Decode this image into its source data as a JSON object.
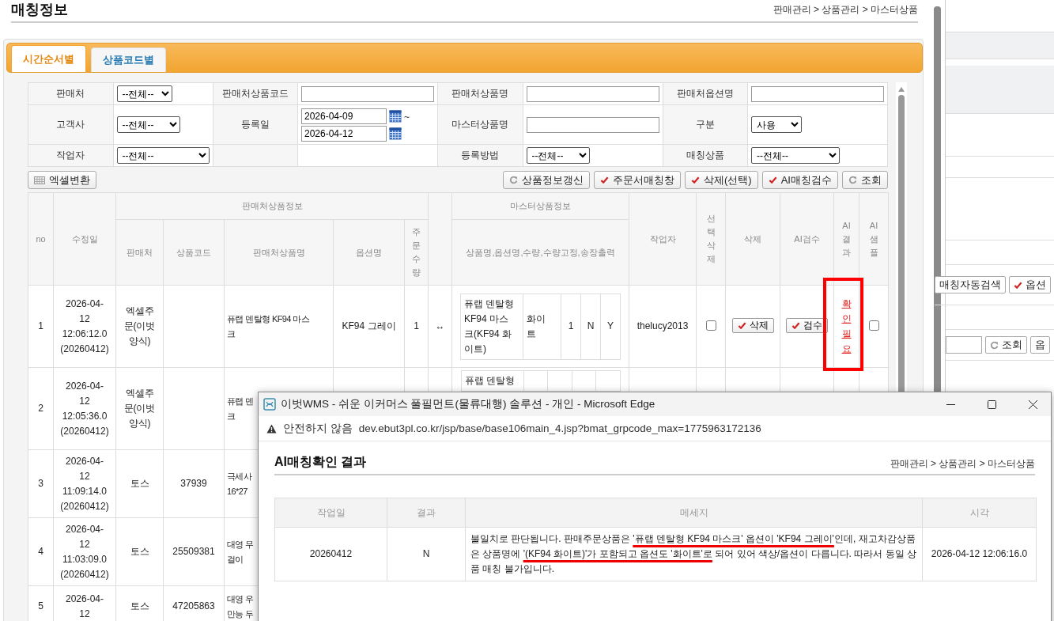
{
  "page": {
    "title": "매칭정보",
    "breadcrumb": "판매관리 > 상품관리 > 마스터상품"
  },
  "tabs": [
    {
      "label": "시간순서별",
      "selected": true
    },
    {
      "label": "상품코드별",
      "selected": false
    }
  ],
  "filters": [
    {
      "label": "판매처",
      "kind": "select",
      "value": "--전체--"
    },
    {
      "label": "판매처상품코드",
      "kind": "input"
    },
    {
      "label": "판매처상품명",
      "kind": "input"
    },
    {
      "label": "판매처옵션명",
      "kind": "input"
    },
    {
      "label": "고객사",
      "kind": "select",
      "value": "--전체--"
    },
    {
      "label": "등록일",
      "kind": "daterange",
      "from": "2026-04-09",
      "to": "2026-04-12",
      "separator": "~"
    },
    {
      "label": "마스터상품명",
      "kind": "input"
    },
    {
      "label": "구분",
      "kind": "select",
      "value": "사용"
    },
    {
      "label": "작업자",
      "kind": "select",
      "value": "--전체--"
    },
    {
      "kind": "empty"
    },
    {
      "label": "등록방법",
      "kind": "select",
      "value": "--전체--"
    },
    {
      "label": "매칭상품",
      "kind": "select",
      "value": "--전체--"
    }
  ],
  "left_buttons": [
    {
      "label": "엑셀변환"
    }
  ],
  "right_buttons": [
    {
      "label": "상품정보갱신"
    },
    {
      "label": "주문서매칭창"
    },
    {
      "label": "삭제(선택)"
    },
    {
      "label": "AI매칭검수"
    },
    {
      "label": "조회"
    }
  ],
  "table": {
    "group_headers": [
      "판매처상품정보",
      "마스터상품정보"
    ],
    "columns": [
      "no",
      "수정일",
      "판매처",
      "상품코드",
      "판매처상품명",
      "옵션명",
      "주\n문\n수\n량",
      "상품명,옵션명,수량,수량고정,송장출력",
      "작업자",
      "선\n택\n삭\n제",
      "삭제",
      "AI검수",
      "AI\n결\n과",
      "AI\n샘\n플"
    ],
    "rows": [
      {
        "no": "1",
        "modified": "2026-04-\n12\n12:06:12.0\n(20260412)",
        "seller": "엑셀주\n문(이벗\n양식)",
        "product_name": "퓨랩 덴탈형 KF94 마스\n크",
        "option": "KF94 그레이",
        "qty": "1",
        "link": "↔",
        "master": {
          "name": "퓨랩 덴탈형\nKF94 마스\n크(KF94 화\n이트)",
          "option": "화이\n트",
          "qty": "1",
          "fixed": "N",
          "invoice": "Y"
        },
        "worker": "thelucy2013",
        "checked": false,
        "delete_label": "삭제",
        "review_label": "검수",
        "ai_result": "확\n인\n필\n요",
        "highlighted": true,
        "sample_checked": false
      },
      {
        "no": "2",
        "modified": "2026-04-\n12\n12:05:36.0\n(20260412)",
        "seller": "엑셀주\n문(이벗\n양식)",
        "product_name": "퓨랩 덴\n크",
        "master": {
          "name": "퓨랩 덴탈형"
        }
      },
      {
        "no": "3",
        "modified": "2026-04-\n12\n11:09:14.0\n(20260412)",
        "seller": "토스",
        "product_code": "37939",
        "product_name": "극세사\n16*27"
      },
      {
        "no": "4",
        "modified": "2026-04-\n12\n11:03:09.0\n(20260412)",
        "seller": "토스",
        "product_code": "25509381",
        "product_name": "대영 무\n걸이"
      },
      {
        "no": "5",
        "modified": "2026-04-\n12",
        "seller": "토스",
        "product_code": "47205863",
        "product_name": "대영 우\n만능 두"
      }
    ]
  },
  "background_window": {
    "auto_search_button": "매칭자동검색",
    "option_button": "옵션",
    "search_button": "조회",
    "field_4": "옵"
  },
  "popup": {
    "title": "이벗WMS - 쉬운 이커머스 풀필먼트(물류대행) 솔루션 - 개인 - Microsoft Edge",
    "security": "안전하지 않음",
    "url": "dev.ebut3pl.co.kr/jsp/base/base106main_4.jsp?bmat_grpcode_max=1775963172136",
    "heading": "AI매칭확인 결과",
    "breadcrumb": "판매관리 > 상품관리 > 마스터상품",
    "columns": [
      "작업일",
      "결과",
      "메세지",
      "시각"
    ],
    "rows": [
      {
        "date": "20260412",
        "result": "N",
        "time": "2026-04-12 12:06:16.0",
        "message": [
          {
            "text": "불일치로 판단됩니다. 판매주문상품은 ",
            "marked": false
          },
          {
            "text": "'퓨랩 덴탈형 KF94 마스크' 옵션이 'KF94 그레이'",
            "marked": true
          },
          {
            "text": "인데, 재고차감상품은 상품명에 ",
            "marked": false
          },
          {
            "text": "'(KF94 화이트)'가 포함되고 옵션도 '화이트'로",
            "marked": true
          },
          {
            "text": " 되어 있어 색상/옵션이 다릅니다. 따라서 동일 상품 매칭 불가입니다.",
            "marked": false
          }
        ]
      }
    ]
  }
}
